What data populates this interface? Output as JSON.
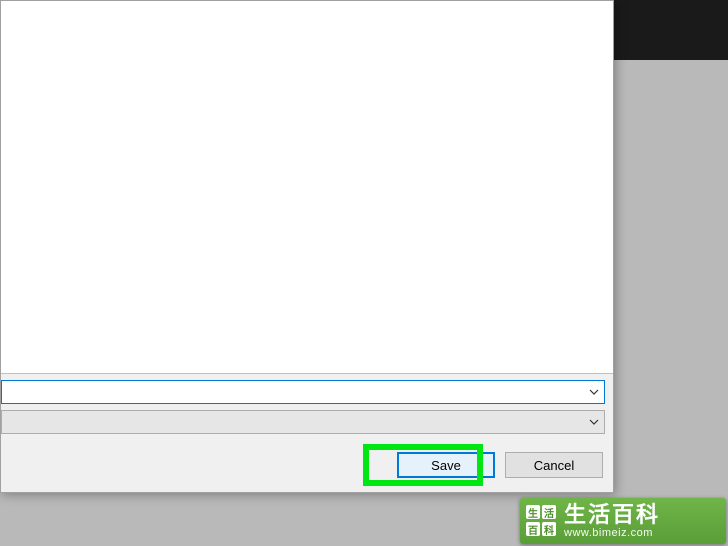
{
  "dialog": {
    "buttons": {
      "save_label": "Save",
      "cancel_label": "Cancel"
    }
  },
  "watermark": {
    "title": "生活百科",
    "url": "www.bimeiz.com"
  }
}
